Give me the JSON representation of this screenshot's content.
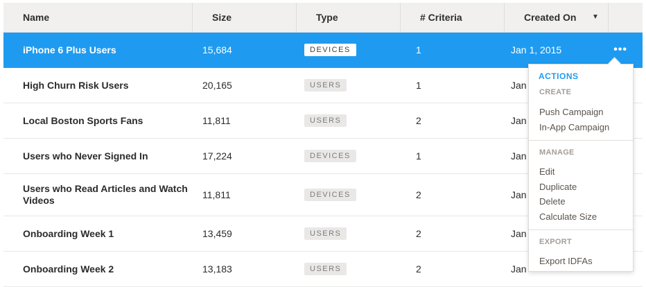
{
  "columns": {
    "name": "Name",
    "size": "Size",
    "type": "Type",
    "criteria": "# Criteria",
    "created_on": "Created On"
  },
  "rows": [
    {
      "name": "iPhone 6 Plus Users",
      "size": "15,684",
      "type": "DEVICES",
      "criteria": "1",
      "created": "Jan 1, 2015"
    },
    {
      "name": "High Churn Risk Users",
      "size": "20,165",
      "type": "USERS",
      "criteria": "1",
      "created": "Jan"
    },
    {
      "name": "Local Boston Sports Fans",
      "size": "11,811",
      "type": "USERS",
      "criteria": "2",
      "created": "Jan"
    },
    {
      "name": "Users who Never Signed In",
      "size": "17,224",
      "type": "DEVICES",
      "criteria": "1",
      "created": "Jan"
    },
    {
      "name": "Users who Read Articles and Watch Videos",
      "size": "11,811",
      "type": "DEVICES",
      "criteria": "2",
      "created": "Jan"
    },
    {
      "name": "Onboarding Week 1",
      "size": "13,459",
      "type": "USERS",
      "criteria": "2",
      "created": "Jan"
    },
    {
      "name": "Onboarding Week 2",
      "size": "13,183",
      "type": "USERS",
      "criteria": "2",
      "created": "Jan"
    }
  ],
  "more_icon": "•••",
  "menu": {
    "title": "ACTIONS",
    "create_header": "CREATE",
    "push_campaign": "Push Campaign",
    "inapp_campaign": "In-App Campaign",
    "manage_header": "MANAGE",
    "edit": "Edit",
    "duplicate": "Duplicate",
    "delete": "Delete",
    "calculate_size": "Calculate Size",
    "export_header": "EXPORT",
    "export_idfas": "Export IDFAs"
  },
  "colors": {
    "accent": "#1e9bf0",
    "header_bg": "#f1f0ef"
  }
}
